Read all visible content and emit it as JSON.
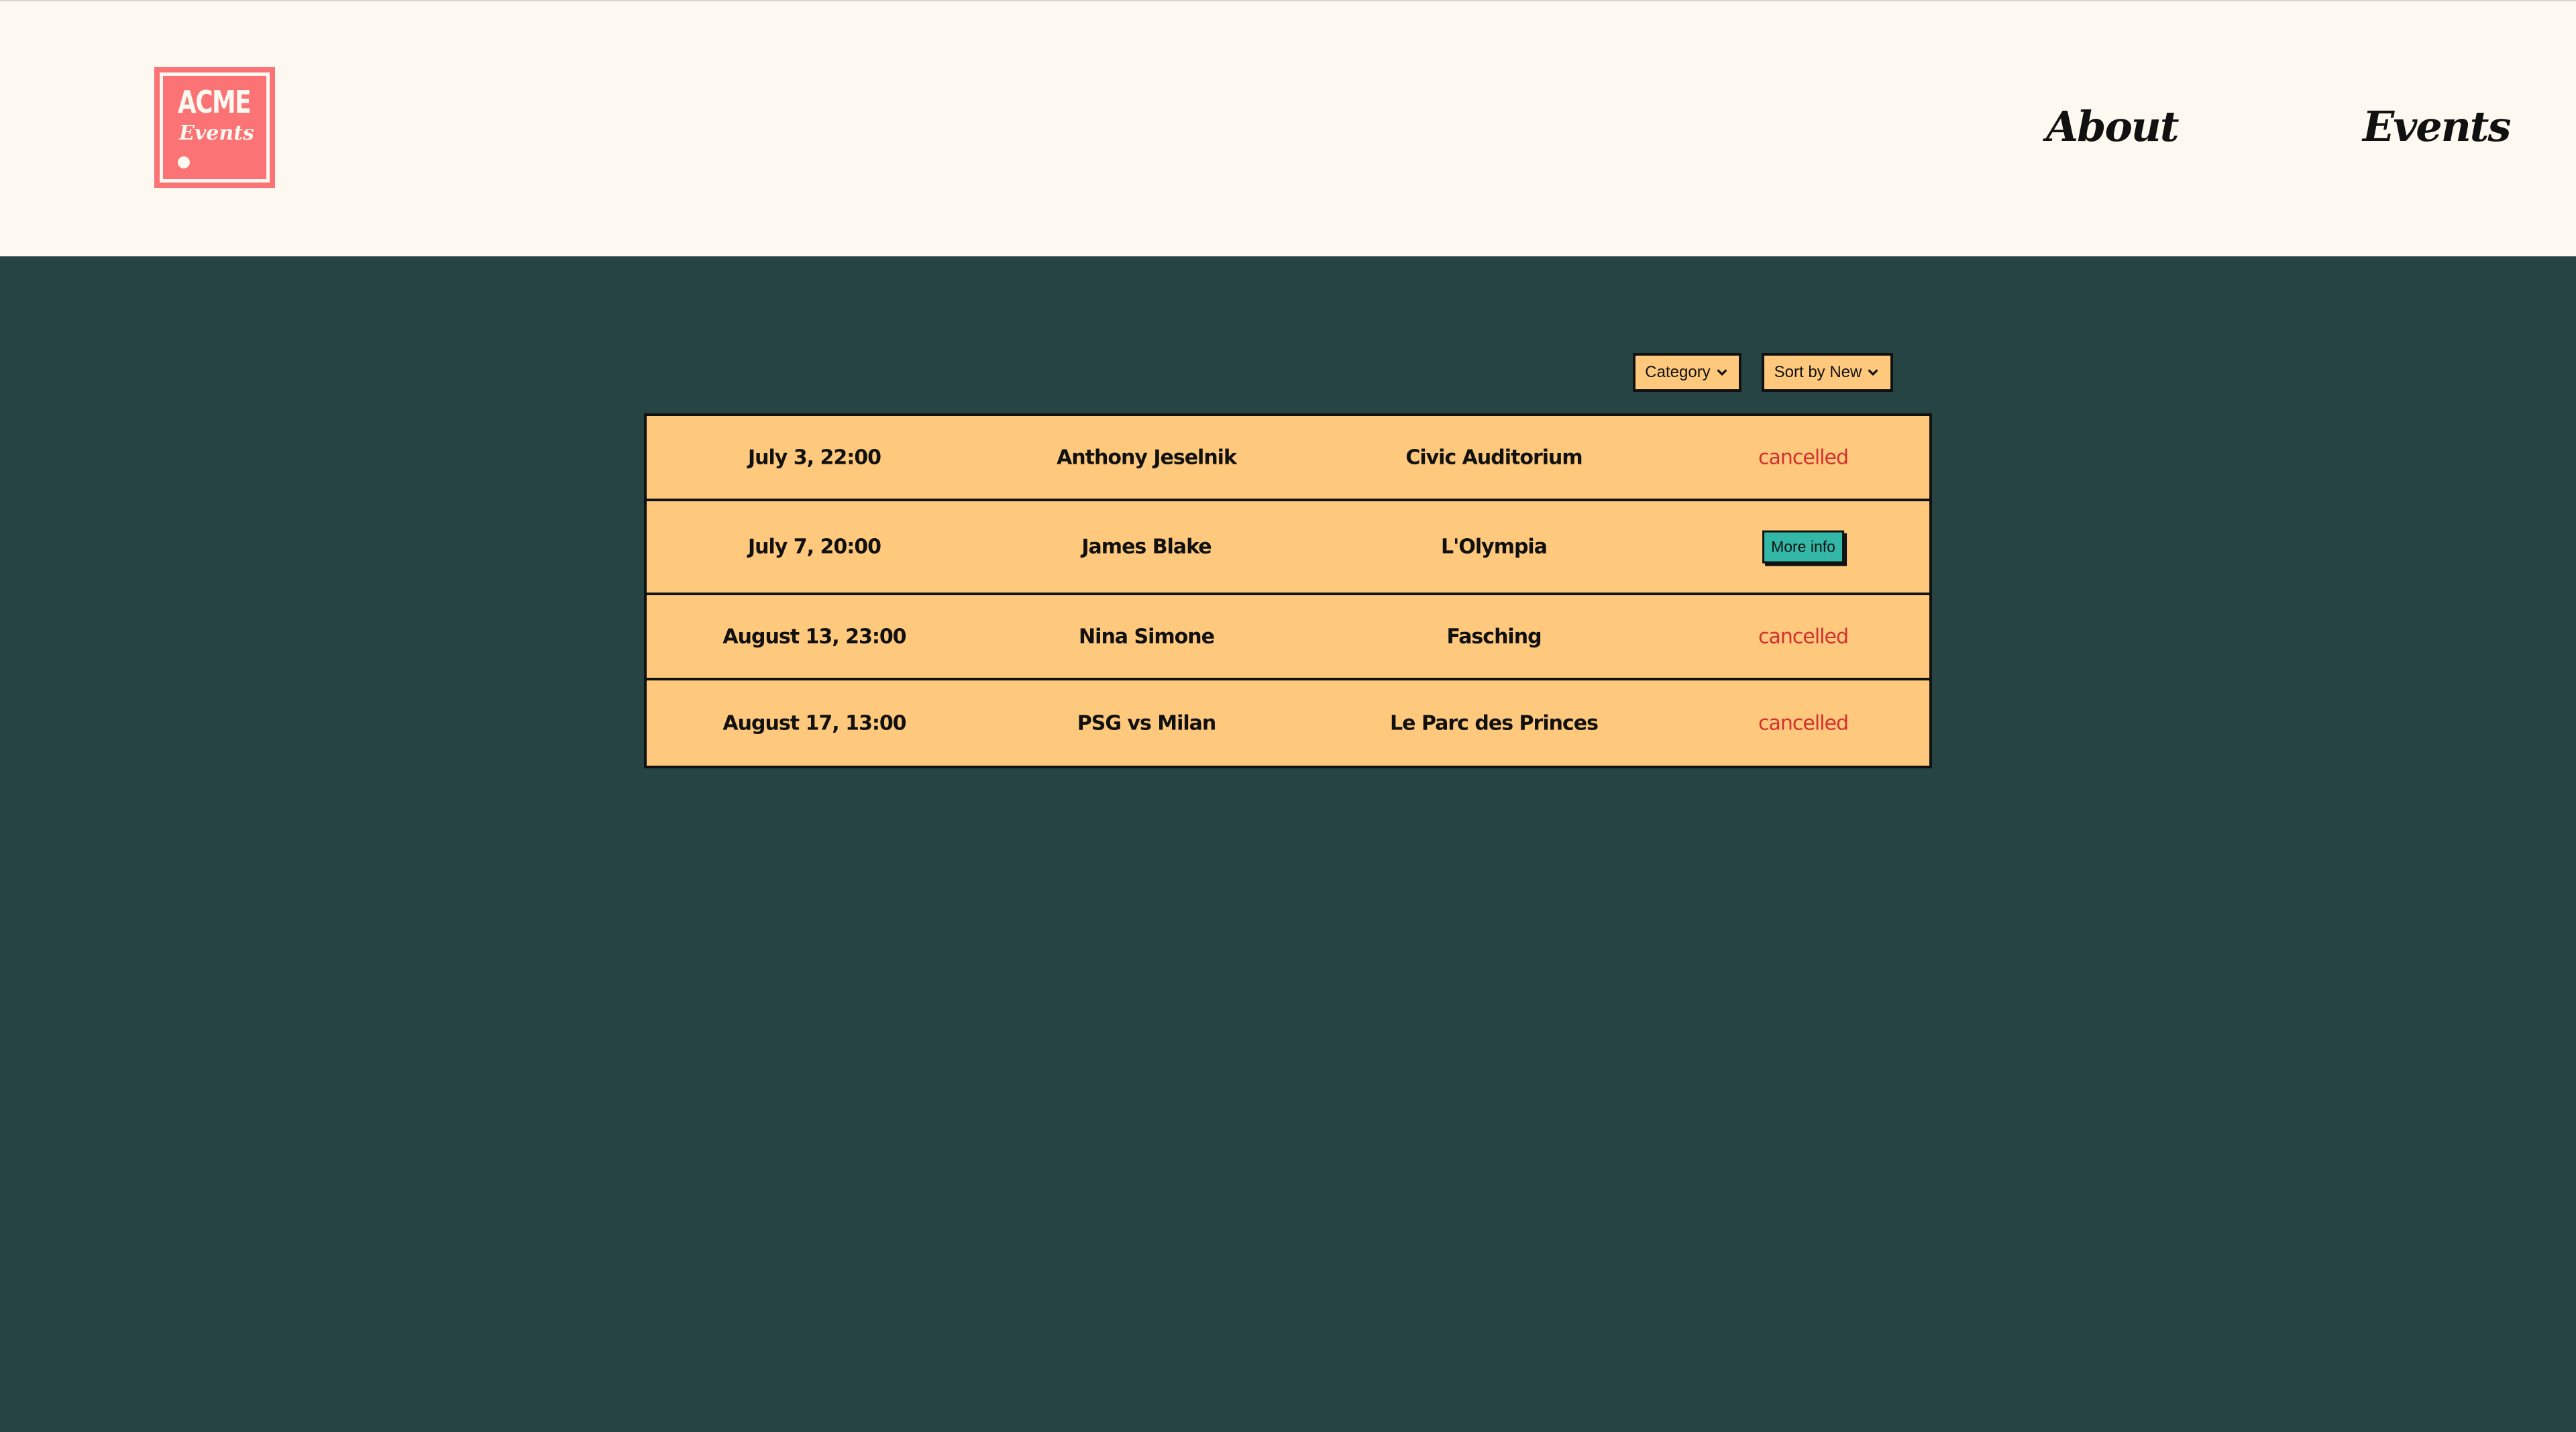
{
  "header": {
    "logo": {
      "line1": "ACME",
      "line2": "Events"
    },
    "nav": [
      {
        "label": "About"
      },
      {
        "label": "Events"
      }
    ]
  },
  "filters": {
    "category_label": "Category",
    "sort_label": "Sort by New"
  },
  "events": [
    {
      "date": "July 3, 22:00",
      "artist": "Anthony Jeselnik",
      "venue": "Civic Auditorium",
      "status": "cancelled"
    },
    {
      "date": "July 7, 20:00",
      "artist": "James Blake",
      "venue": "L'Olympia",
      "action_label": "More info"
    },
    {
      "date": "August 13, 23:00",
      "artist": "Nina Simone",
      "venue": "Fasching",
      "status": "cancelled"
    },
    {
      "date": "August 17, 13:00",
      "artist": "PSG vs Milan",
      "venue": "Le Parc des Princes",
      "status": "cancelled"
    }
  ],
  "colors": {
    "header_bg": "#fdf8f0",
    "page_bg": "#274445",
    "row_bg": "#fec97d",
    "accent_logo": "#fb7374",
    "button_bg": "#33b8a7",
    "cancelled_text": "#d33030"
  },
  "icons": {
    "dropdown": "chevron-down-icon"
  }
}
